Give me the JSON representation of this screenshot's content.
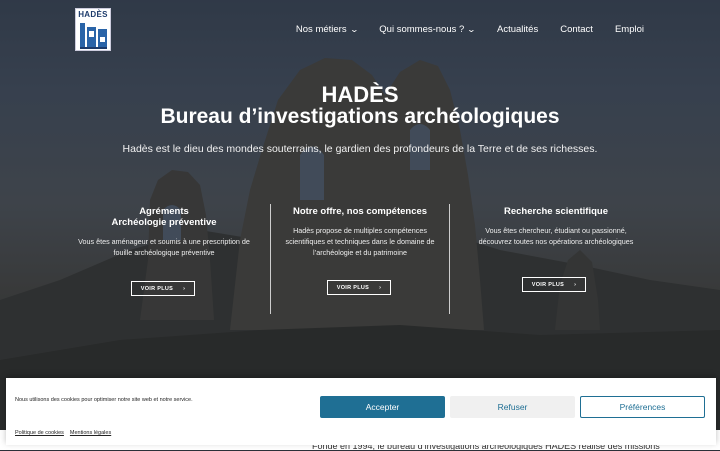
{
  "logo": {
    "text": "HADÈS"
  },
  "nav": {
    "items": [
      {
        "label": "Nos métiers",
        "has_dropdown": true
      },
      {
        "label": "Qui sommes-nous ?",
        "has_dropdown": true
      },
      {
        "label": "Actualités",
        "has_dropdown": false
      },
      {
        "label": "Contact",
        "has_dropdown": false
      },
      {
        "label": "Emploi",
        "has_dropdown": false
      }
    ]
  },
  "hero": {
    "title": "HADÈS",
    "subtitle_title": "Bureau d’investigations archéologiques",
    "tagline": "Hadès est le dieu des mondes souterrains, le gardien des profondeurs de la Terre et de ses richesses."
  },
  "columns": [
    {
      "title_line1": "Agréments",
      "title_line2": "Archéologie préventive",
      "text": "Vous êtes aménageur et soumis à une prescription de fouille archéologique préventive",
      "button": "VOIR PLUS"
    },
    {
      "title_line1": "Notre offre, nos compétences",
      "title_line2": "",
      "text": "Hadès propose de multiples compétences scientifiques et techniques dans le domaine de l’archéologie et du patrimoine",
      "button": "VOIR PLUS"
    },
    {
      "title_line1": "Recherche scientifique",
      "title_line2": "",
      "text": "Vous êtes chercheur, étudiant ou passionné, découvrez toutes nos opérations archéologiques",
      "button": "VOIR PLUS"
    }
  ],
  "cookie": {
    "message": "Nous utilisons des cookies pour optimiser notre site web et notre service.",
    "accept": "Accepter",
    "refuse": "Refuser",
    "preferences": "Préférences",
    "policy_link": "Politique de cookies",
    "legal_link": "Mentions légales"
  },
  "below_fold": {
    "text": "Fondé en 1994, le bureau d’investigations archéologiques HADÈS réalise des missions"
  },
  "colors": {
    "accent": "#1f6f94",
    "hero_overlay": "#141923"
  }
}
